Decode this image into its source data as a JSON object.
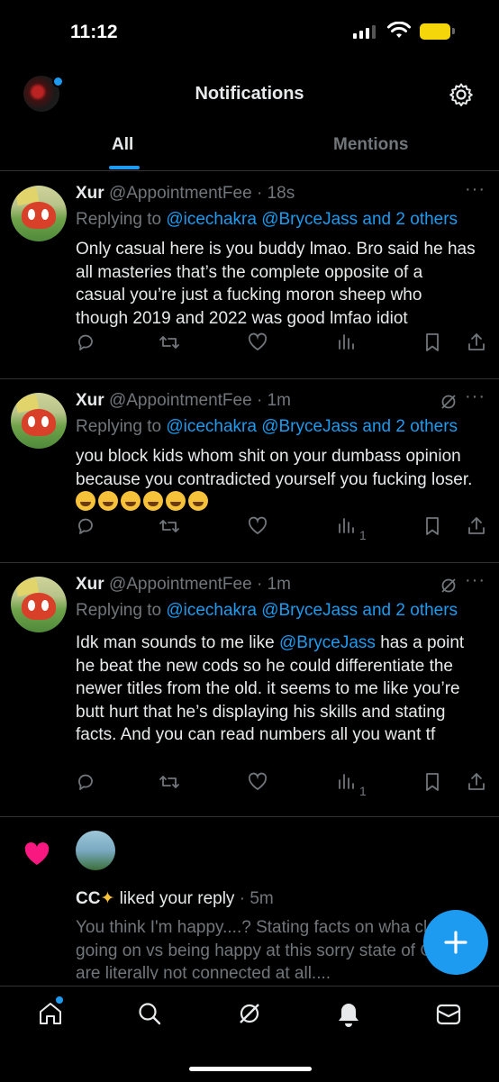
{
  "status": {
    "time": "11:12"
  },
  "header": {
    "title": "Notifications"
  },
  "tabs": [
    {
      "label": "All"
    },
    {
      "label": "Mentions"
    }
  ],
  "tweets": [
    {
      "name": "Xur",
      "handle": "@AppointmentFee",
      "time": "18s",
      "reply_prefix": "Replying to",
      "reply_to": "@icechakra @BryceJass and 2 others",
      "text": "Only casual here is you buddy lmao. Bro said he has all masteries that’s the complete opposite of a casual you’re just a fucking moron sheep who though 2019 and 2022 was good lmfao idiot",
      "views": ""
    },
    {
      "name": "Xur",
      "handle": "@AppointmentFee",
      "time": "1m",
      "reply_prefix": "Replying to",
      "reply_to": "@icechakra @BryceJass and 2 others",
      "text": "you block kids whom shit on your dumbass opinion because you contradicted yourself you fucking loser.",
      "views": "1"
    },
    {
      "name": "Xur",
      "handle": "@AppointmentFee",
      "time": "1m",
      "reply_prefix": "Replying to",
      "reply_to": "@icechakra @BryceJass and 2 others",
      "text_before": "Idk man sounds to me like ",
      "text_mention": "@BryceJass",
      "text_after": " has a point he beat the new cods so he could differentiate the newer titles from the old. it seems to me like you’re butt hurt that he’s displaying his skills and stating facts. And you can read numbers all you want tf",
      "views": "1"
    }
  ],
  "like_notification": {
    "user": "CC",
    "action": "liked your reply",
    "time": "5m",
    "preview": "You think I'm happy....? Stating facts on wha clearly going on vs being happy at this sorry state of CoD are literally not connected at all...."
  },
  "colors": {
    "accent": "#1d9bf0",
    "heart": "#f91880",
    "background": "#000000",
    "muted": "#71767b"
  }
}
